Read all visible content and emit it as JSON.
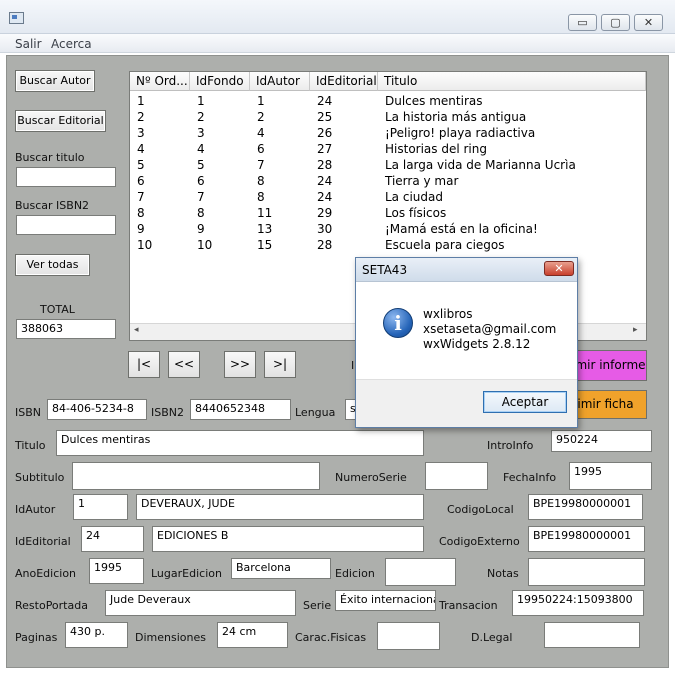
{
  "window": {
    "minimize": "▭",
    "maximize": "▢",
    "close": "✕"
  },
  "menu": {
    "items": [
      "Salir",
      "Acerca"
    ]
  },
  "left_panel": {
    "buscar_autor": "Buscar Autor",
    "buscar_editorial": "Buscar Editorial",
    "buscar_titulo_label": "Buscar titulo",
    "buscar_titulo_value": "",
    "buscar_isbn_label": "Buscar ISBN2",
    "buscar_isbn_value": "",
    "ver_todas": "Ver todas",
    "total_label": "TOTAL",
    "total_value": "388063"
  },
  "table": {
    "columns": [
      "Nº Ord...",
      "IdFondo",
      "IdAutor",
      "IdEditorial",
      "Titulo"
    ],
    "rows": [
      [
        "1",
        "1",
        "1",
        "24",
        "Dulces mentiras"
      ],
      [
        "2",
        "2",
        "2",
        "25",
        "La historia más antigua"
      ],
      [
        "3",
        "3",
        "4",
        "26",
        "¡Peligro! playa radiactiva"
      ],
      [
        "4",
        "4",
        "6",
        "27",
        "Historias del ring"
      ],
      [
        "5",
        "5",
        "7",
        "28",
        "La larga vida de Marianna Ucrìa"
      ],
      [
        "6",
        "6",
        "8",
        "24",
        "Tierra y mar"
      ],
      [
        "7",
        "7",
        "8",
        "24",
        "La ciudad"
      ],
      [
        "8",
        "8",
        "11",
        "29",
        "Los físicos"
      ],
      [
        "9",
        "9",
        "13",
        "30",
        "¡Mamá está en la oficina!"
      ],
      [
        "10",
        "10",
        "15",
        "28",
        "Escuela para ciegos"
      ]
    ]
  },
  "nav": {
    "first": "|<",
    "prev": "<<",
    "next": ">>",
    "last": ">|"
  },
  "actions": {
    "imprimir_informe": "mir informe",
    "imprimir_ficha": "imir ficha",
    "partial_label": "I"
  },
  "form": {
    "isbn_label": "ISBN",
    "isbn": "84-406-5234-8",
    "isbn2_label": "ISBN2",
    "isbn2": "8440652348",
    "lengua_label": "Lengua",
    "lengua": "s",
    "titulo_label": "Titulo",
    "titulo": "Dulces mentiras",
    "introinfo_label": "IntroInfo",
    "introinfo": "950224",
    "subtitulo_label": "Subtitulo",
    "subtitulo": "",
    "numeroserie_label": "NumeroSerie",
    "numeroserie": "",
    "fechainfo_label": "FechaInfo",
    "fechainfo": "1995",
    "idautor_label": "IdAutor",
    "idautor": "1",
    "autor_nombre": "DEVERAUX, JUDE",
    "codigolocal_label": "CodigoLocal",
    "codigolocal": "BPE19980000001",
    "ideditorial_label": "IdEditorial",
    "ideditorial": "24",
    "editorial_nombre": "EDICIONES B",
    "codigoexterno_label": "CodigoExterno",
    "codigoexterno": "BPE19980000001",
    "anoedicion_label": "AnoEdicion",
    "anoedicion": "1995",
    "lugaredicion_label": "LugarEdicion",
    "lugaredicion": "Barcelona",
    "edicion_label": "Edicion",
    "edicion": "",
    "notas_label": "Notas",
    "notas": "",
    "restoportada_label": "RestoPortada",
    "restoportada": "Jude Deveraux",
    "serie_label": "Serie",
    "serie": "Éxito internacional",
    "transacion_label": "Transacion",
    "transacion": "19950224:15093800",
    "paginas_label": "Paginas",
    "paginas": "430 p.",
    "dimensiones_label": "Dimensiones",
    "dimensiones": "24 cm",
    "caracfisicas_label": "Carac.Fisicas",
    "caracfisicas": "",
    "dlegal_label": "D.Legal",
    "dlegal": ""
  },
  "dialog": {
    "title": "SETA43",
    "close": "✕",
    "icon": "info-icon",
    "icon_glyph": "i",
    "line1": "wxlibros",
    "line2": "xsetaseta@gmail.com",
    "line3": "wxWidgets 2.8.12",
    "ok": "Aceptar"
  },
  "colors": {
    "client_bg": "#adafac",
    "informe_btn": "#e65be6",
    "ficha_btn": "#f0a22b"
  }
}
